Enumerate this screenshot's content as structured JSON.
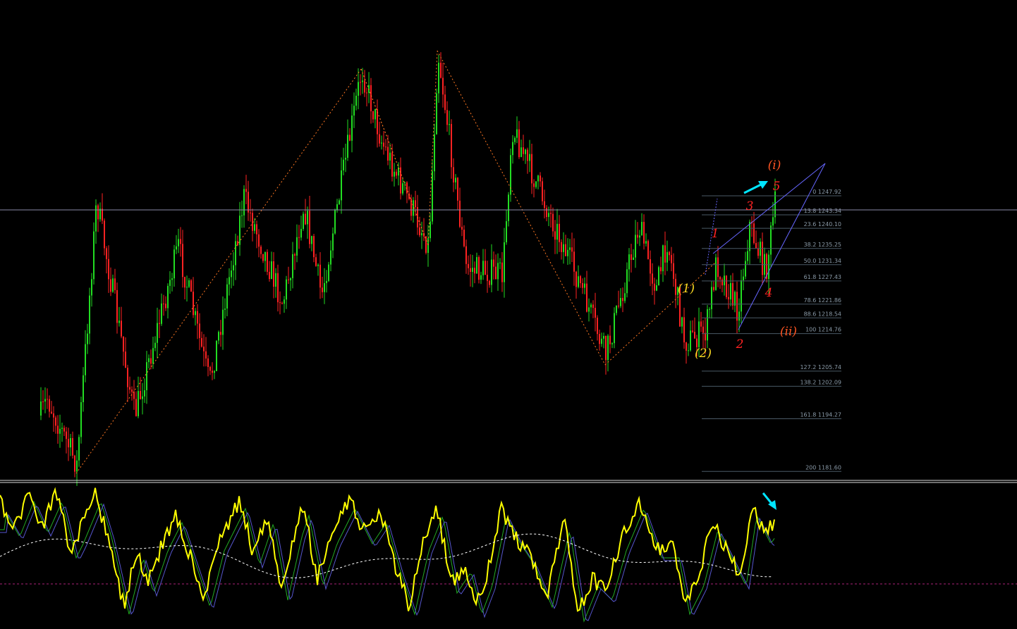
{
  "chart_data": [
    {
      "type": "candlestick",
      "title": "",
      "ylim": [
        1175,
        1275
      ],
      "colors": {
        "up": "#22dd22",
        "down": "#ff2222",
        "background": "#000000",
        "zigzag": "#ff7722",
        "channel": "#6666ff",
        "hline": "#8888aa",
        "arrow": "#00e5ff"
      },
      "fibonacci": {
        "levels": [
          {
            "label": "0 1247.92",
            "ratio": 0,
            "price": 1247.92
          },
          {
            "label": "13.8 1243.34",
            "ratio": 13.8,
            "price": 1243.34
          },
          {
            "label": "23.6 1240.10",
            "ratio": 23.6,
            "price": 1240.1
          },
          {
            "label": "38.2 1235.25",
            "ratio": 38.2,
            "price": 1235.25
          },
          {
            "label": "50.0 1231.34",
            "ratio": 50.0,
            "price": 1231.34
          },
          {
            "label": "61.8 1227.43",
            "ratio": 61.8,
            "price": 1227.43
          },
          {
            "label": "78.6 1221.86",
            "ratio": 78.6,
            "price": 1221.86
          },
          {
            "label": "88.6 1218.54",
            "ratio": 88.6,
            "price": 1218.54
          },
          {
            "label": "100 1214.76",
            "ratio": 100,
            "price": 1214.76
          },
          {
            "label": "127.2 1205.74",
            "ratio": 127.2,
            "price": 1205.74
          },
          {
            "label": "138.2 1202.09",
            "ratio": 138.2,
            "price": 1202.09
          },
          {
            "label": "161.8 1194.27",
            "ratio": 161.8,
            "price": 1194.27
          },
          {
            "label": "200 1181.60",
            "ratio": 200,
            "price": 1181.6
          }
        ]
      },
      "wave_labels": [
        {
          "text": "(i)",
          "color": "#ff5522"
        },
        {
          "text": "5",
          "color": "#ff2222"
        },
        {
          "text": "3",
          "color": "#ff2222"
        },
        {
          "text": "1",
          "color": "#ff2222"
        },
        {
          "text": "(1)",
          "color": "#ffdd22"
        },
        {
          "text": "4",
          "color": "#ff2222"
        },
        {
          "text": "(ii)",
          "color": "#ff5522"
        },
        {
          "text": "2",
          "color": "#ff2222"
        },
        {
          "text": "(2)",
          "color": "#ffdd22"
        }
      ]
    },
    {
      "type": "line",
      "title": "",
      "series": [
        {
          "color": "#ffff00"
        },
        {
          "color": "#22aa22"
        },
        {
          "color": "#5555cc"
        },
        {
          "color": "#ffffff"
        }
      ]
    }
  ]
}
